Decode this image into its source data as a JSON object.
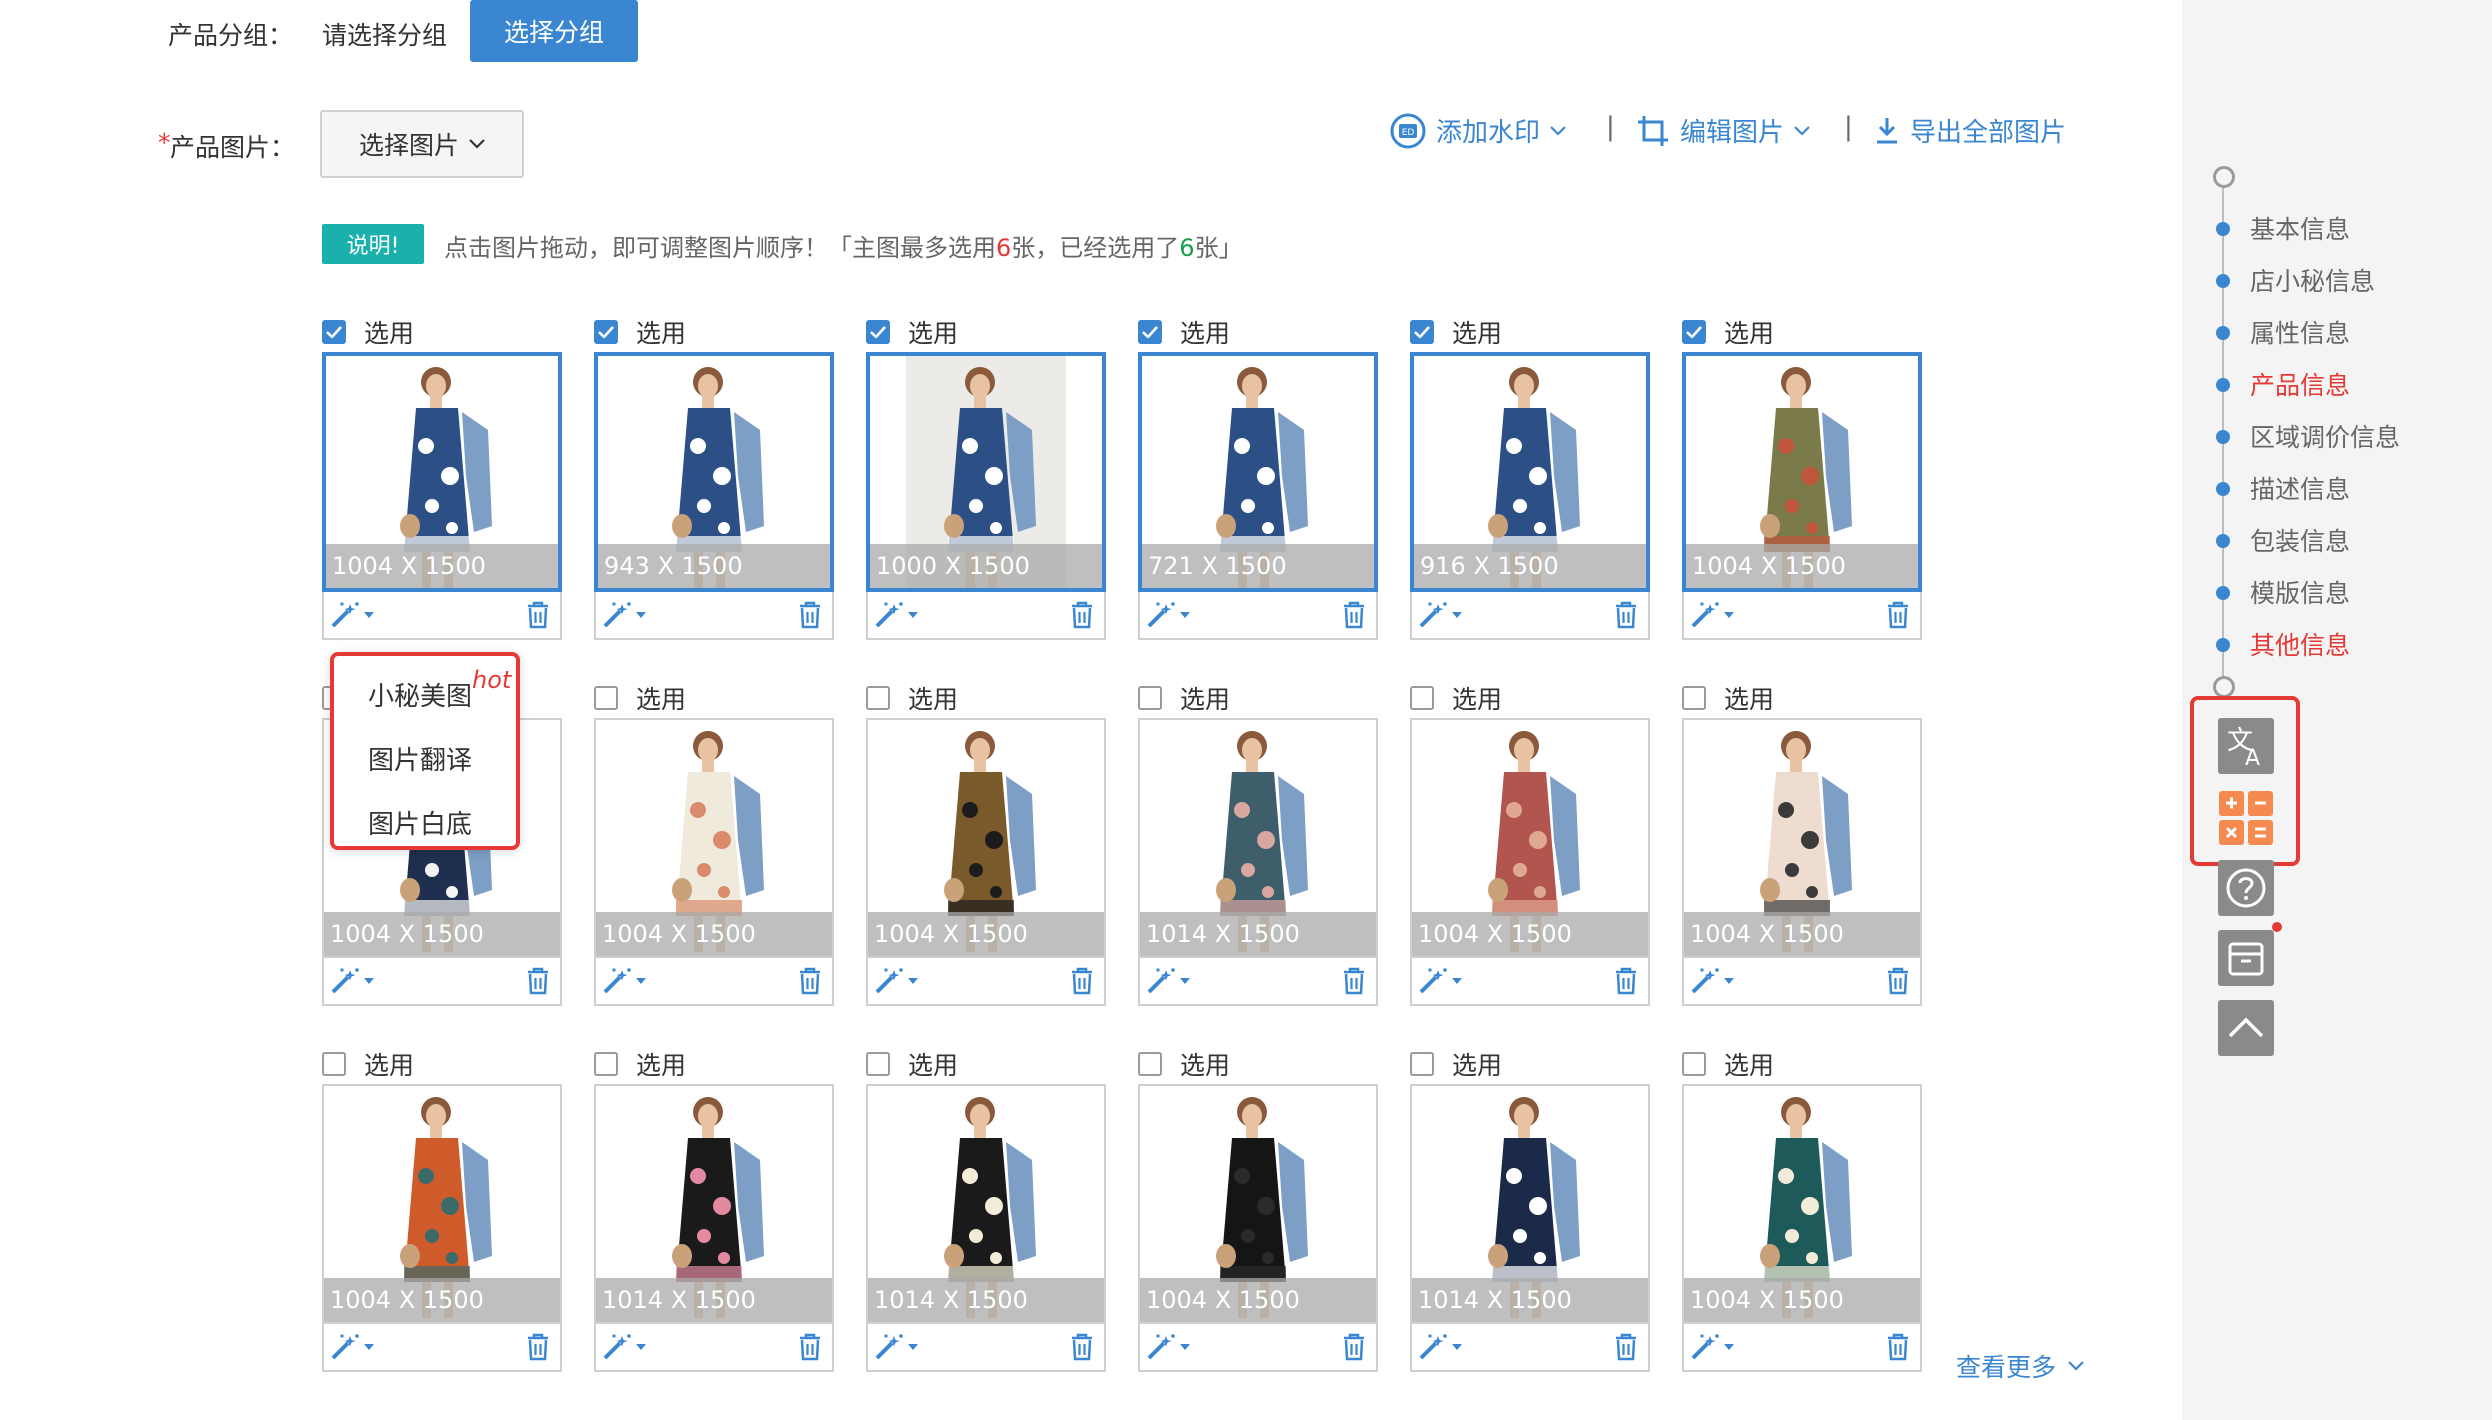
{
  "form": {
    "group_label": "产品分组：",
    "group_placeholder": "请选择分组",
    "group_button": "选择分组",
    "images_required_mark": "*",
    "images_label": "产品图片：",
    "select_images_button": "选择图片"
  },
  "toolbar": {
    "watermark": "添加水印",
    "edit_images": "编辑图片",
    "export_all": "导出全部图片",
    "separator": "|"
  },
  "note": {
    "badge": "说明!",
    "text_a": "点击图片拖动，即可调整图片顺序！「主图最多选用",
    "max_count": "6",
    "text_b": "张，已经选用了",
    "used_count": "6",
    "text_c": "张」"
  },
  "check_label": "选用",
  "cards": [
    {
      "size": "1004 X 1500",
      "checked": true
    },
    {
      "size": "943 X 1500",
      "checked": true
    },
    {
      "size": "1000 X 1500",
      "checked": true
    },
    {
      "size": "721 X 1500",
      "checked": true
    },
    {
      "size": "916 X 1500",
      "checked": true
    },
    {
      "size": "1004 X 1500",
      "checked": true
    },
    {
      "size": "1004 X 1500",
      "checked": false
    },
    {
      "size": "1004 X 1500",
      "checked": false
    },
    {
      "size": "1004 X 1500",
      "checked": false
    },
    {
      "size": "1014 X 1500",
      "checked": false
    },
    {
      "size": "1004 X 1500",
      "checked": false
    },
    {
      "size": "1004 X 1500",
      "checked": false
    },
    {
      "size": "1004 X 1500",
      "checked": false
    },
    {
      "size": "1014 X 1500",
      "checked": false
    },
    {
      "size": "1014 X 1500",
      "checked": false
    },
    {
      "size": "1004 X 1500",
      "checked": false
    },
    {
      "size": "1014 X 1500",
      "checked": false
    },
    {
      "size": "1004 X 1500",
      "checked": false
    }
  ],
  "dropdown": {
    "items": [
      "小秘美图",
      "图片翻译",
      "图片白底"
    ],
    "hot_tag": "hot"
  },
  "see_more": "查看更多",
  "side_nav": {
    "items": [
      "基本信息",
      "店小秘信息",
      "属性信息",
      "产品信息",
      "区域调价信息",
      "描述信息",
      "包装信息",
      "模版信息",
      "其他信息"
    ]
  },
  "colors": {
    "accent": "#3a86d1",
    "highlight": "#e53935",
    "badge": "#1ab1ac"
  }
}
